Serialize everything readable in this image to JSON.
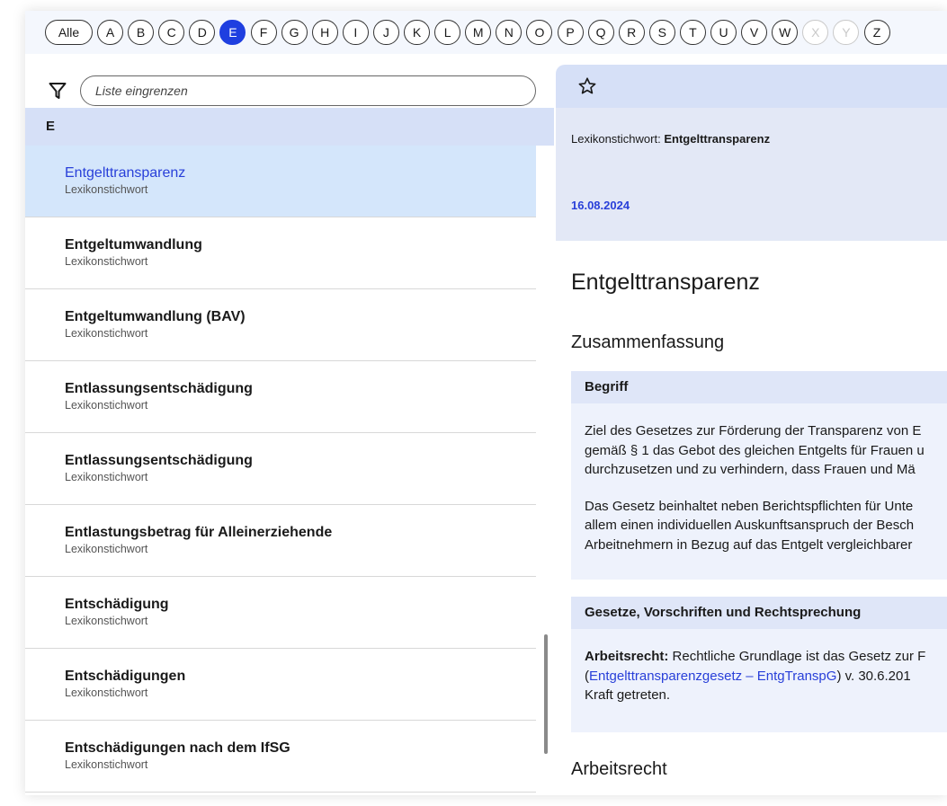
{
  "alphabet": {
    "all_label": "Alle",
    "letters": [
      "A",
      "B",
      "C",
      "D",
      "E",
      "F",
      "G",
      "H",
      "I",
      "J",
      "K",
      "L",
      "M",
      "N",
      "O",
      "P",
      "Q",
      "R",
      "S",
      "T",
      "U",
      "V",
      "W",
      "X",
      "Y",
      "Z"
    ],
    "active": "E",
    "disabled": [
      "X",
      "Y"
    ]
  },
  "search": {
    "placeholder": "Liste eingrenzen"
  },
  "group_letter": "E",
  "items": [
    {
      "title": "Entgelttransparenz",
      "type": "Lexikonstichwort"
    },
    {
      "title": "Entgeltumwandlung",
      "type": "Lexikonstichwort"
    },
    {
      "title": "Entgeltumwandlung (BAV)",
      "type": "Lexikonstichwort"
    },
    {
      "title": "Entlassungsentschädigung",
      "type": "Lexikonstichwort"
    },
    {
      "title": "Entlassungsentschädigung",
      "type": "Lexikonstichwort"
    },
    {
      "title": "Entlastungsbetrag für Alleinerziehende",
      "type": "Lexikonstichwort"
    },
    {
      "title": "Entschädigung",
      "type": "Lexikonstichwort"
    },
    {
      "title": "Entschädigungen",
      "type": "Lexikonstichwort"
    },
    {
      "title": "Entschädigungen nach dem IfSG",
      "type": "Lexikonstichwort"
    }
  ],
  "detail": {
    "kind_label": "Lexikonstichwort:",
    "kind_value": "Entgelttransparenz",
    "date": "16.08.2024",
    "title": "Entgelttransparenz",
    "summary_heading": "Zusammenfassung",
    "box1": {
      "heading": "Begriff",
      "p1": [
        "Ziel des Gesetzes zur Förderung der Transparenz von E",
        "gemäß § 1 das Gebot des gleichen Entgelts für Frauen u",
        "durchzusetzen und zu verhindern, dass Frauen und Mä"
      ],
      "p2": [
        "Das Gesetz beinhaltet neben Berichtspflichten für Unte",
        "allem einen individuellen Auskunftsanspruch der Besch",
        "Arbeitnehmern in Bezug auf das Entgelt vergleichbarer"
      ]
    },
    "box2": {
      "heading": "Gesetze, Vorschriften und Rechtsprechung",
      "bold": "Arbeitsrecht:",
      "line1_rest": " Rechtliche Grundlage ist das Gesetz zur F",
      "paren_open": "(",
      "link": "Entgelttransparenzgesetz – EntgTranspG",
      "line2_rest": ") v. 30.6.201",
      "line3": "Kraft getreten."
    },
    "section2": "Arbeitsrecht"
  },
  "colors": {
    "accent": "#1f3fe0",
    "link": "#2940d9",
    "header_bg": "#d6e0f7",
    "selected_bg": "#d4e6fb"
  }
}
